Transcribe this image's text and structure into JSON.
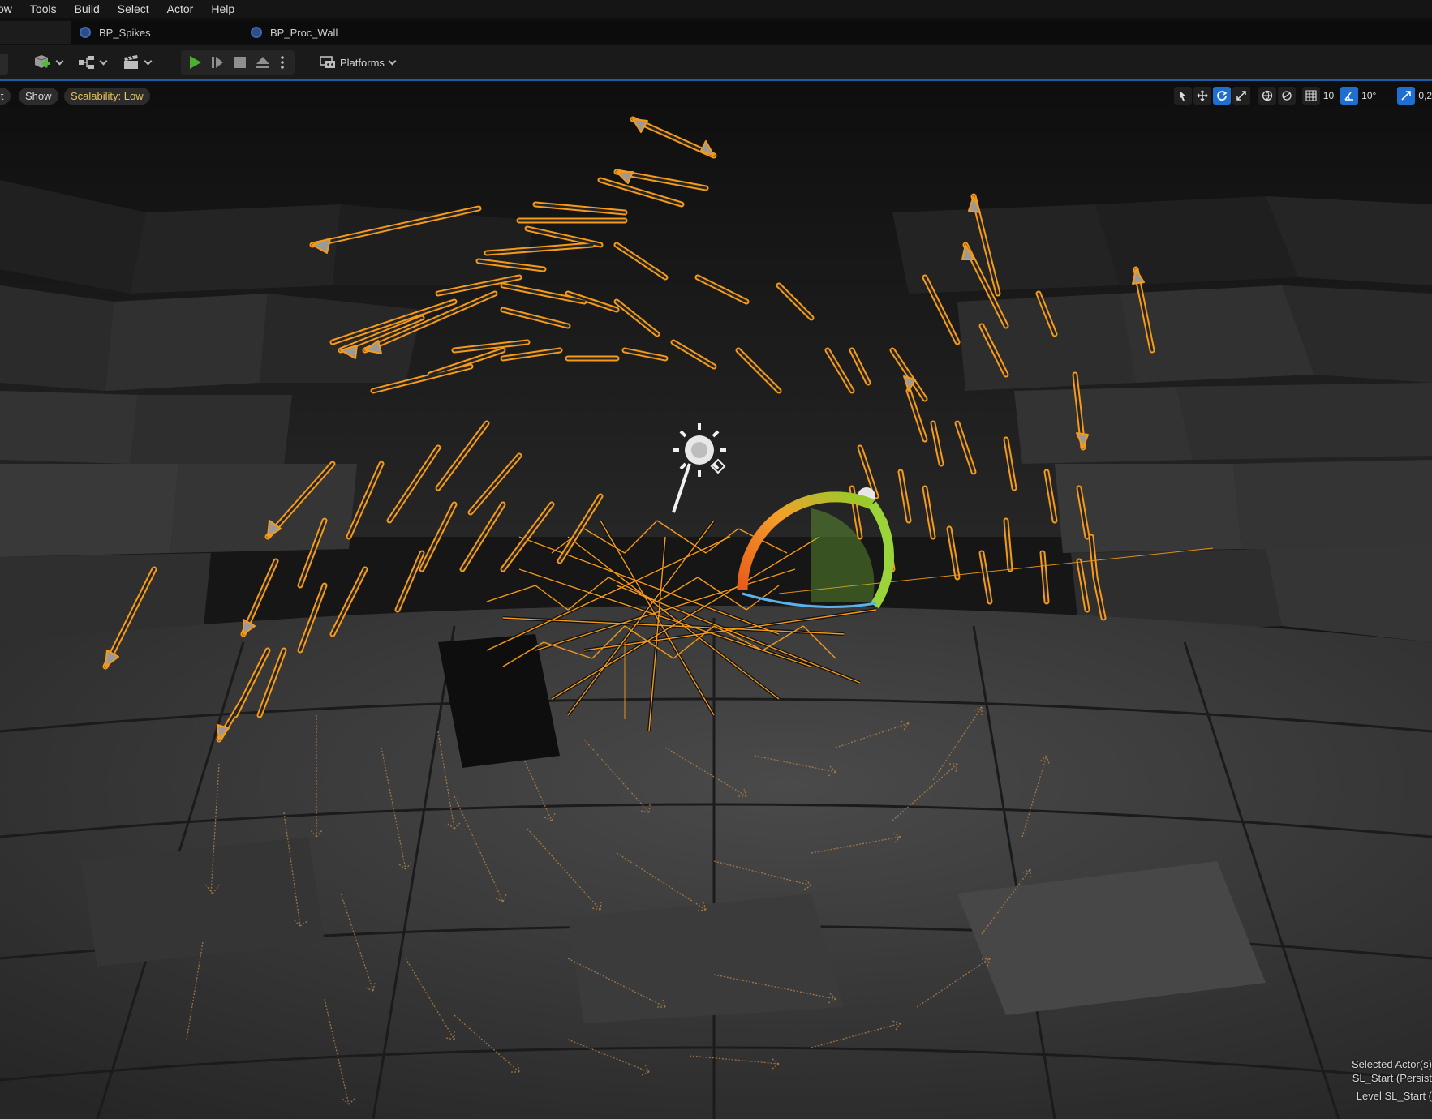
{
  "menu": {
    "items": [
      "ow",
      "Tools",
      "Build",
      "Select",
      "Actor",
      "Help"
    ]
  },
  "tabs": [
    {
      "label": "BP_Spikes"
    },
    {
      "label": "BP_Proc_Wall"
    }
  ],
  "toolbar": {
    "platforms_label": "Platforms"
  },
  "viewport": {
    "edit_label": "it",
    "show_label": "Show",
    "scalability_label": "Scalability: Low",
    "grid_snap_value": "10",
    "rotation_snap_value": "10°",
    "scale_snap_value": "0,2"
  },
  "info": {
    "selected_actors": "Selected Actor(s)",
    "selected_name": "SL_Start (Persist",
    "level": "Level  SL_Start ("
  },
  "colors": {
    "selection_orange": "#f59a1a",
    "accent_blue": "#1f6fd1",
    "scalability_yellow": "#e8c55a",
    "play_green": "#4caf32"
  }
}
